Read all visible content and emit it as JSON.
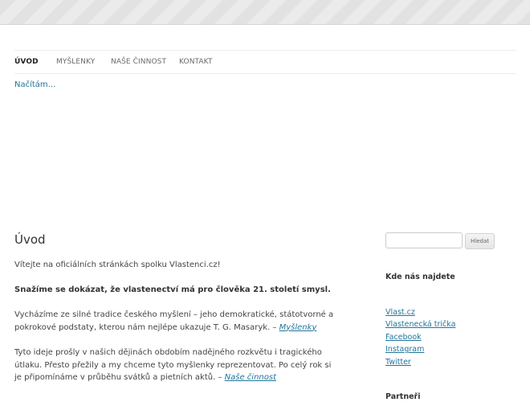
{
  "nav": {
    "items": [
      {
        "label": "ÚVOD"
      },
      {
        "label": "MYŠLENKY"
      },
      {
        "label": "NAŠE ČINNOST"
      },
      {
        "label": "KONTAKT"
      }
    ]
  },
  "loading_text": "Načítám...",
  "main": {
    "title": "Úvod",
    "intro": "Vítejte na oficiálních stránkách spolku Vlastenci.cz!",
    "bold_line": "Snažíme se dokázat, že vlastenectví má pro člověka 21. století smysl.",
    "p1_text": "Vycházíme ze silné tradice českého myšlení – jeho demokratické, státotvorné a pokrokové podstaty, kterou nám nejlépe ukazuje T. G. Masaryk. –",
    "p1_link": "Myšlenky",
    "p2_text": "Tyto ideje prošly v našich dějinách obdobím nadějného rozkvětu i tragického útlaku. Přesto přežily a my chceme tyto myšlenky reprezentovat. Po celý rok si je připomínáme v průběhu svátků a pietních aktů. –",
    "p2_link": "Naše činnost"
  },
  "sidebar": {
    "search_placeholder": "",
    "search_button": "Hledat",
    "find_us_title": "Kde nás najdete",
    "links": [
      {
        "label": "Vlast.cz"
      },
      {
        "label": "Vlastenecká trička"
      },
      {
        "label": "Facebook"
      },
      {
        "label": "Instagram"
      },
      {
        "label": "Twitter"
      }
    ],
    "partners_title": "Partneři"
  },
  "colors": {
    "link": "#21759b",
    "text": "#444444"
  }
}
